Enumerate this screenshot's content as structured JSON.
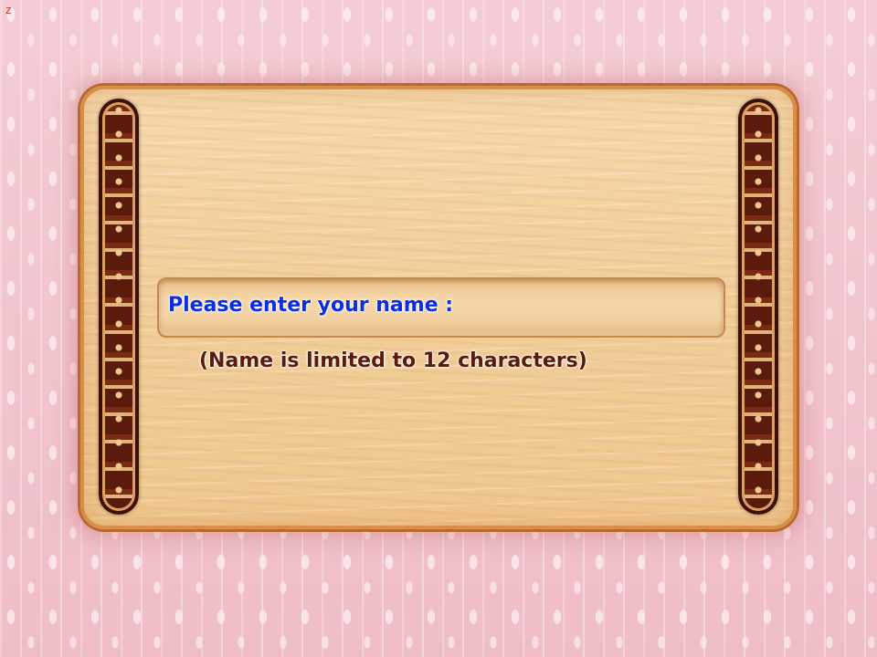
{
  "corner_mark": "z",
  "dialog": {
    "prompt_label": "Please enter your name :",
    "name_value": "",
    "hint": "(Name is limited to 12 characters)"
  },
  "colors": {
    "prompt": "#0a2ee0",
    "hint": "#5a1a0c",
    "wallpaper": "#f2c6cd",
    "board": "#f3d0a0"
  },
  "icons": {
    "left_ornament": "scroll-ornament-icon",
    "right_ornament": "scroll-ornament-icon"
  }
}
